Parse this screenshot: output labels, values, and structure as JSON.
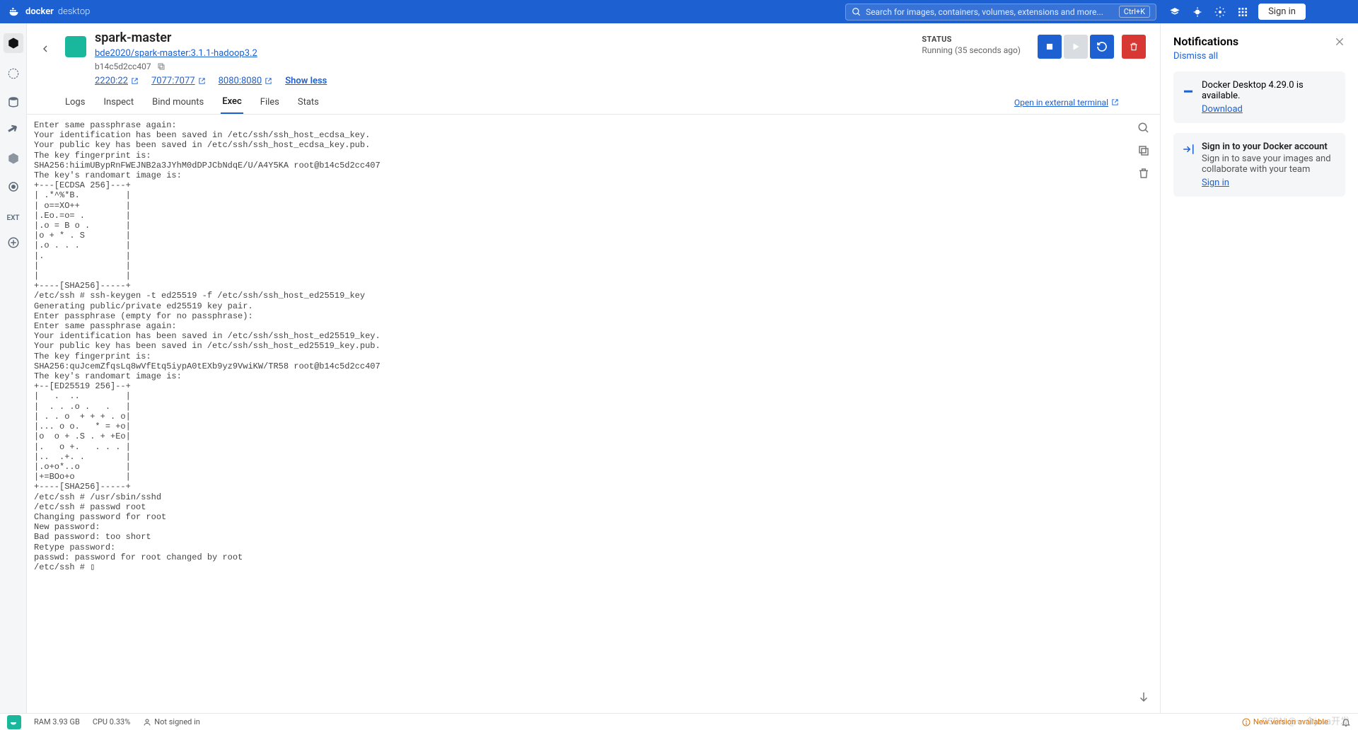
{
  "titlebar": {
    "brand_bold": "docker",
    "brand_light": "desktop",
    "search_placeholder": "Search for images, containers, volumes, extensions and more...",
    "shortcut": "Ctrl+K",
    "signin": "Sign in"
  },
  "sidebar": {
    "ext_label": "EXT"
  },
  "header": {
    "title": "spark-master",
    "image_link": "bde2020/spark-master:3.1.1-hadoop3.2",
    "container_id": "b14c5d2cc407",
    "ports": [
      "2220:22",
      "7077:7077",
      "8080:8080"
    ],
    "show_less": "Show less",
    "status_label": "STATUS",
    "status_value": "Running (35 seconds ago)"
  },
  "tabs": {
    "items": [
      "Logs",
      "Inspect",
      "Bind mounts",
      "Exec",
      "Files",
      "Stats"
    ],
    "active": "Exec",
    "open_external": "Open in external terminal"
  },
  "terminal_output": "Enter same passphrase again:\nYour identification has been saved in /etc/ssh/ssh_host_ecdsa_key.\nYour public key has been saved in /etc/ssh/ssh_host_ecdsa_key.pub.\nThe key fingerprint is:\nSHA256:hiimUBypRnFWEJNB2a3JYhM0dDPJCbNdqE/U/A4Y5KA root@b14c5d2cc407\nThe key's randomart image is:\n+---[ECDSA 256]---+\n| .*^%*B.         |\n| o==XO++         |\n|.Eo.=o= .        |\n|.o = B o .       |\n|o + * . S        |\n|.o . . .         |\n|.                |\n|                 |\n|                 |\n+----[SHA256]-----+\n/etc/ssh # ssh-keygen -t ed25519 -f /etc/ssh/ssh_host_ed25519_key\nGenerating public/private ed25519 key pair.\nEnter passphrase (empty for no passphrase):\nEnter same passphrase again:\nYour identification has been saved in /etc/ssh/ssh_host_ed25519_key.\nYour public key has been saved in /etc/ssh/ssh_host_ed25519_key.pub.\nThe key fingerprint is:\nSHA256:quJcemZfqsLq8wVfEtq5iypA0tEXb9yz9VwiKW/TR58 root@b14c5d2cc407\nThe key's randomart image is:\n+--[ED25519 256]--+\n|   .  ..         |\n|  . . .o .   .   |\n| . . o  + + + . o|\n|... o o.   * = +o|\n|o  o + .S . + +Eo|\n|.   o +.   . . . |\n|..  .+. .        |\n|.o+o*..o         |\n|+=BOo+o          |\n+----[SHA256]-----+\n/etc/ssh # /usr/sbin/sshd\n/etc/ssh # passwd root\nChanging password for root\nNew password:\nBad password: too short\nRetype password:\npasswd: password for root changed by root\n/etc/ssh # ▯",
  "notifications": {
    "title": "Notifications",
    "dismiss": "Dismiss all",
    "cards": [
      {
        "title": "Docker Desktop 4.29.0 is available.",
        "link": "Download"
      },
      {
        "title": "Sign in to your Docker account",
        "sub": "Sign in to save your images and collaborate with your team",
        "link": "Sign in"
      }
    ]
  },
  "statusbar": {
    "ram": "RAM 3.93 GB",
    "cpu": "CPU 0.33%",
    "not_signed": "Not signed in",
    "new_version": "New version available"
  },
  "watermark": "CSDN @一个java开发"
}
